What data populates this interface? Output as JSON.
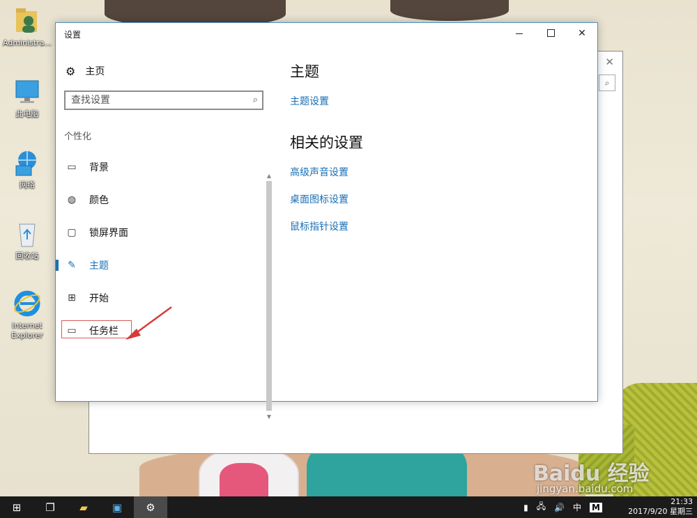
{
  "desktop": {
    "icons": [
      {
        "label": "Administra..."
      },
      {
        "label": "此电脑"
      },
      {
        "label": "网络"
      },
      {
        "label": "回收站"
      },
      {
        "label": "Internet Explorer"
      }
    ]
  },
  "settings": {
    "title": "设置",
    "home_label": "主页",
    "search_placeholder": "查找设置",
    "section_title": "个性化",
    "nav_items": [
      {
        "label": "背景",
        "icon": "image-icon"
      },
      {
        "label": "颜色",
        "icon": "palette-icon"
      },
      {
        "label": "锁屏界面",
        "icon": "lock-screen-icon"
      },
      {
        "label": "主题",
        "icon": "theme-icon",
        "active": true
      },
      {
        "label": "开始",
        "icon": "start-icon"
      },
      {
        "label": "任务栏",
        "icon": "taskbar-icon"
      }
    ],
    "content": {
      "heading": "主题",
      "theme_settings_link": "主题设置",
      "related_heading": "相关的设置",
      "related_links": [
        "高级声音设置",
        "桌面图标设置",
        "鼠标指针设置"
      ]
    }
  },
  "taskbar": {
    "tray_ime": "中",
    "tray_m": "M",
    "time": "21:33",
    "date": "2017/9/20 星期三"
  },
  "watermark": {
    "line1": "Baidu 经验",
    "line2": "jingyan.baidu.com"
  },
  "colors": {
    "accent": "#1a6fb5",
    "highlight": "#d85a5a",
    "taskbar": "#1b1b1b"
  }
}
